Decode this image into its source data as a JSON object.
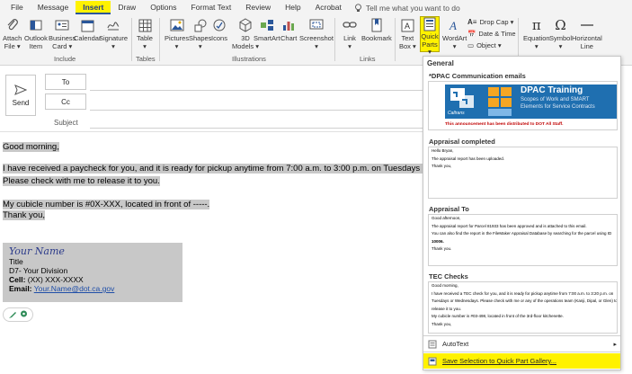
{
  "menubar": {
    "items": [
      "File",
      "Message",
      "Insert",
      "Draw",
      "Options",
      "Format Text",
      "Review",
      "Help",
      "Acrobat"
    ],
    "active": "Insert",
    "tell_me": "Tell me what you want to do"
  },
  "ribbon": {
    "include": {
      "label": "Include",
      "buttons": [
        {
          "label1": "Attach",
          "label2": "File ▾"
        },
        {
          "label1": "Outlook",
          "label2": "Item"
        },
        {
          "label1": "Business",
          "label2": "Card ▾"
        },
        {
          "label1": "Calendar",
          "label2": ""
        },
        {
          "label1": "Signature",
          "label2": "▾"
        }
      ]
    },
    "tables": {
      "label": "Tables",
      "button": {
        "label1": "Table",
        "label2": "▾"
      }
    },
    "illustrations": {
      "label": "Illustrations",
      "buttons": [
        {
          "label1": "Pictures",
          "label2": "▾"
        },
        {
          "label1": "Shapes",
          "label2": "▾"
        },
        {
          "label1": "Icons",
          "label2": ""
        },
        {
          "label1": "3D",
          "label2": "Models ▾"
        },
        {
          "label1": "SmartArt",
          "label2": ""
        },
        {
          "label1": "Chart",
          "label2": ""
        },
        {
          "label1": "Screenshot",
          "label2": "▾"
        }
      ]
    },
    "links": {
      "label": "Links",
      "buttons": [
        {
          "label1": "Link",
          "label2": "▾"
        },
        {
          "label1": "Bookmark",
          "label2": ""
        }
      ]
    },
    "text": {
      "buttons": [
        {
          "label1": "Text",
          "label2": "Box ▾"
        },
        {
          "label1": "Quick",
          "label2": "Parts ▾"
        },
        {
          "label1": "WordArt",
          "label2": "▾"
        }
      ],
      "small": [
        "Drop Cap ▾",
        "Date & Time",
        "Object ▾"
      ]
    },
    "symbols": {
      "buttons": [
        {
          "label1": "Equation",
          "label2": "▾"
        },
        {
          "label1": "Symbol",
          "label2": "▾"
        },
        {
          "label1": "Horizontal",
          "label2": "Line"
        }
      ]
    }
  },
  "compose": {
    "send": "Send",
    "to": "To",
    "cc": "Cc",
    "subject": "Subject",
    "body": [
      "Good morning,",
      "",
      "I have received a paycheck for you, and it is ready for pickup anytime from 7:00 a.m. to 3:00 p.m. on Tuesdays or We",
      "Please check with me to release it to you.",
      "",
      "My cubicle number is #0X-XXX, located in front of -----.",
      "Thank you,"
    ],
    "signature": {
      "name": "Your Name",
      "title": "Title",
      "division": "D7- Your Division",
      "cell_label": "Cell:",
      "cell": "(XX) XXX-XXXX",
      "email_label": "Email:",
      "email": "Your.Name@dot.ca.gov"
    }
  },
  "gallery": {
    "header": "General",
    "entries": [
      {
        "title": "*DPAC Communication emails",
        "banner_title": "DPAC Training",
        "banner_sub1": "Scopes of Work and SMART",
        "banner_sub2": "Elements for Service Contracts",
        "banner_logo": "Caltrans",
        "note": "This announcement has been distributed to DOT All Staff."
      },
      {
        "title": "Appraisal completed",
        "lines": [
          "Hello Bryan,",
          "",
          "The appraisal report has been uploaded.",
          "",
          "Thank you,"
        ]
      },
      {
        "title": "Appraisal To",
        "lines": [
          "Good afternoon,",
          "",
          "The appraisal report for Parcel 81933 has been approved and is attached to this email.",
          "",
          "You can also find the report in the FileMaker Appraisal Database by searching for the parcel using ID",
          "10006.",
          "Thank you."
        ]
      },
      {
        "title": "TEC Checks",
        "lines": [
          "Good morning,",
          "",
          "I have received a TEC check for you, and it is ready for pickup anytime from 7:00 a.m. to 3:20 p.m. on",
          "Tuesdays or Wednesdays. Please check with me or any of the operations team (Kanji, Dipal, or Glen) to",
          "release it to you.",
          "",
          "My cubicle number is #03-498, located in front of the 3rd-floor kitchenette.",
          "Thank you,"
        ]
      }
    ],
    "autotext": "AutoText",
    "save_selection": "Save Selection to Quick Part Gallery..."
  }
}
